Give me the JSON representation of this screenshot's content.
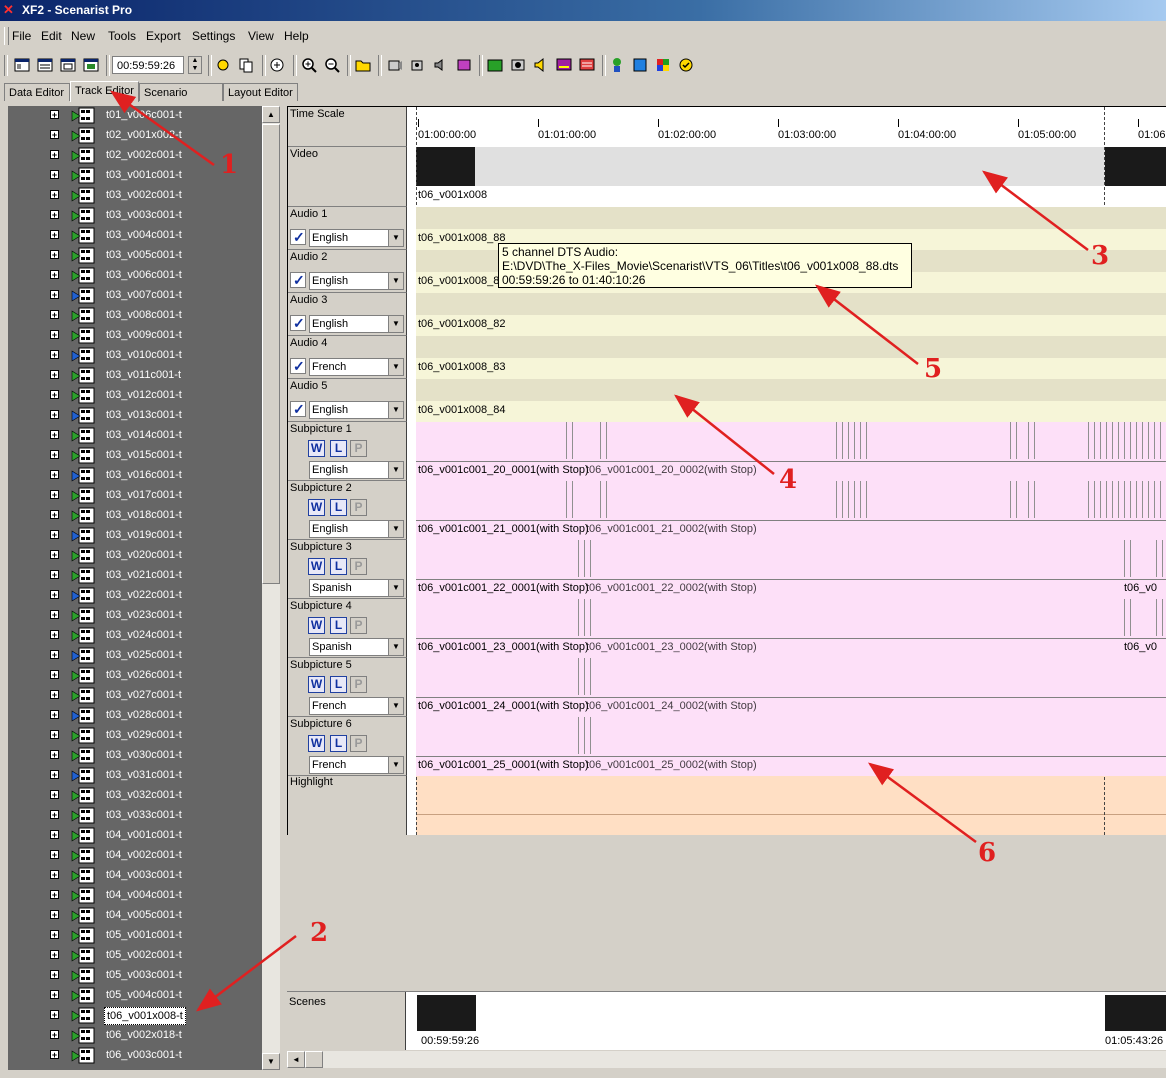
{
  "window": {
    "title": "XF2 - Scenarist Pro"
  },
  "menu": [
    "File",
    "Edit",
    "New",
    "Tools",
    "Export",
    "Settings",
    "View",
    "Help"
  ],
  "toolbar": {
    "time_value": "00:59:59:26"
  },
  "tabs": [
    "Data Editor",
    "Track Editor",
    "Scenario Editor",
    "Layout Editor"
  ],
  "tracks_list": [
    "t01_v006c001-t",
    "t02_v001x002-t",
    "t02_v002c001-t",
    "t03_v001c001-t",
    "t03_v002c001-t",
    "t03_v003c001-t",
    "t03_v004c001-t",
    "t03_v005c001-t",
    "t03_v006c001-t",
    "t03_v007c001-t",
    "t03_v008c001-t",
    "t03_v009c001-t",
    "t03_v010c001-t",
    "t03_v011c001-t",
    "t03_v012c001-t",
    "t03_v013c001-t",
    "t03_v014c001-t",
    "t03_v015c001-t",
    "t03_v016c001-t",
    "t03_v017c001-t",
    "t03_v018c001-t",
    "t03_v019c001-t",
    "t03_v020c001-t",
    "t03_v021c001-t",
    "t03_v022c001-t",
    "t03_v023c001-t",
    "t03_v024c001-t",
    "t03_v025c001-t",
    "t03_v026c001-t",
    "t03_v027c001-t",
    "t03_v028c001-t",
    "t03_v029c001-t",
    "t03_v030c001-t",
    "t03_v031c001-t",
    "t03_v032c001-t",
    "t03_v033c001-t",
    "t04_v001c001-t",
    "t04_v002c001-t",
    "t04_v003c001-t",
    "t04_v004c001-t",
    "t04_v005c001-t",
    "t05_v001c001-t",
    "t05_v002c001-t",
    "t05_v003c001-t",
    "t05_v004c001-t",
    "t06_v001x008-t",
    "t06_v002x018-t",
    "t06_v003c001-t"
  ],
  "selected_track": "t06_v001x008-t",
  "timescale": {
    "label": "Time Scale",
    "ticks": [
      "01:00:00:00",
      "01:01:00:00",
      "01:02:00:00",
      "01:03:00:00",
      "01:04:00:00",
      "01:05:00:00",
      "01:06"
    ]
  },
  "video": {
    "label": "Video",
    "clip": "t06_v001x008"
  },
  "audio": [
    {
      "label": "Audio 1",
      "lang": "English",
      "clip": "t06_v001x008_88"
    },
    {
      "label": "Audio 2",
      "lang": "English",
      "clip": "t06_v001x008_8"
    },
    {
      "label": "Audio 3",
      "lang": "English",
      "clip": "t06_v001x008_82"
    },
    {
      "label": "Audio 4",
      "lang": "French",
      "clip": "t06_v001x008_83"
    },
    {
      "label": "Audio 5",
      "lang": "English",
      "clip": "t06_v001x008_84"
    }
  ],
  "subpictures": [
    {
      "label": "Subpicture 1",
      "lang": "English",
      "clip": "t06_v001c001_20_0001(with Stop)",
      "extra": "t06_v001c001_20_0002(with Stop)"
    },
    {
      "label": "Subpicture 2",
      "lang": "English",
      "clip": "t06_v001c001_21_0001(with Stop)",
      "extra": "t06_v001c001_21_0002(with Stop)"
    },
    {
      "label": "Subpicture 3",
      "lang": "Spanish",
      "clip": "t06_v001c001_22_0001(with Stop)",
      "extra": "t06_v001c001_22_0002(with Stop)"
    },
    {
      "label": "Subpicture 4",
      "lang": "Spanish",
      "clip": "t06_v001c001_23_0001(with Stop)",
      "extra": "t06_v001c001_23_0002(with Stop)"
    },
    {
      "label": "Subpicture 5",
      "lang": "French",
      "clip": "t06_v001c001_24_0001(with Stop)",
      "extra": "t06_v001c001_24_0002(with Stop)"
    },
    {
      "label": "Subpicture 6",
      "lang": "French",
      "clip": "t06_v001c001_25_0001(with Stop)",
      "extra": "t06_v001c001_25_0002(with Stop)"
    }
  ],
  "sub_buttons": {
    "w": "W",
    "l": "L",
    "p": "P"
  },
  "subpicture_right_clip": "t06_v0",
  "highlight": {
    "label": "Highlight"
  },
  "tooltip": {
    "line1": "5 channel DTS Audio:",
    "line2": "E:\\DVD\\The_X-Files_Movie\\Scenarist\\VTS_06\\Titles\\t06_v001x008_88.dts",
    "line3": "00:59:59:26 to 01:40:10:26"
  },
  "scenes": {
    "label": "Scenes",
    "start": "00:59:59:26",
    "end": "01:05:43:26"
  },
  "annotations": [
    "1",
    "2",
    "3",
    "4",
    "5",
    "6"
  ],
  "colors": {
    "audio_lane": "#f6f5d8",
    "audio_lane_alt": "#e4e1c8",
    "subpicture_lane": "#fde0f8",
    "highlight_lane": "#ffdfc4",
    "video_block": "#1a1a1a",
    "video_lane": "#e0e0e0",
    "panel_bg": "#666666",
    "annotation": "#e02020"
  }
}
